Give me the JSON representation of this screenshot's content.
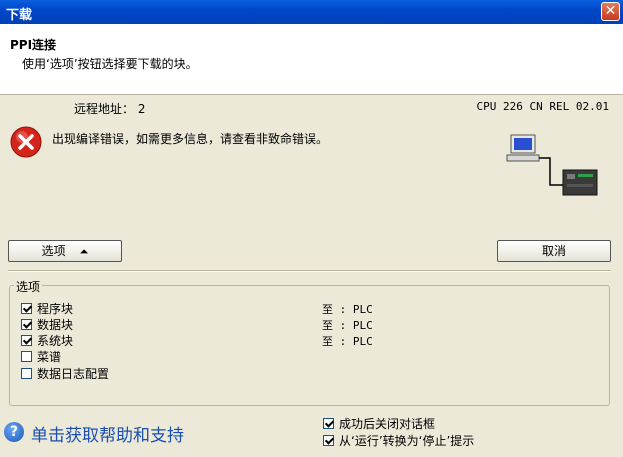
{
  "window": {
    "title": "下载",
    "close_label": "✕"
  },
  "header": {
    "title": "PPI连接",
    "subtitle": "使用‘选项’按钮选择要下载的块。"
  },
  "info": {
    "remote_address": "远程地址： 2",
    "cpu": "CPU 226 CN REL 02.01",
    "error_message": "出现编译错误，如需更多信息，请查看非致命错误。"
  },
  "buttons": {
    "options_label": "选项",
    "options_arrow": "⏶",
    "cancel_label": "取消"
  },
  "options_group": {
    "label": "选项",
    "items": [
      {
        "label": "程序块",
        "checked": true,
        "target": "至 : PLC"
      },
      {
        "label": "数据块",
        "checked": true,
        "target": "至 : PLC"
      },
      {
        "label": "系统块",
        "checked": true,
        "target": "至 : PLC"
      },
      {
        "label": "菜谱",
        "checked": false,
        "target": ""
      },
      {
        "label": "数据日志配置",
        "checked": false,
        "target": ""
      }
    ]
  },
  "footer": {
    "help_text": "单击获取帮助和支持",
    "help_icon": "?",
    "close_after_success": {
      "label": "成功后关闭对话框",
      "checked": true
    },
    "run_to_stop_prompt": {
      "label": "从‘运行’转换为‘停止’提示",
      "checked": true
    }
  },
  "colors": {
    "titlebar": "#0047C8",
    "background": "#ECE9D8",
    "error_red": "#D4251C",
    "link_blue": "#1A4FAF"
  }
}
